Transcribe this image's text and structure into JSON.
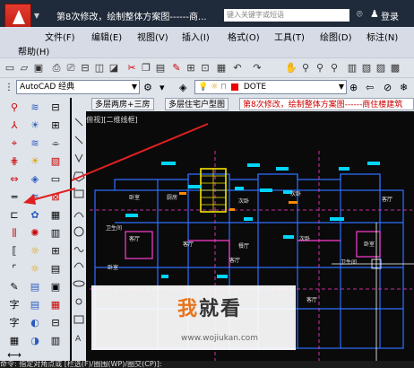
{
  "title_bar": {
    "doc_title": "第8次修改，绘制整体方案图------商...",
    "search_placeholder": "键入关键字或短语",
    "login": "登录"
  },
  "menu": {
    "row1": [
      "文件(F)",
      "编辑(E)",
      "视图(V)",
      "插入(I)",
      "格式(O)",
      "工具(T)",
      "绘图(D)",
      "标注(N)"
    ],
    "row2": [
      "帮助(H)"
    ]
  },
  "toolbar2": {
    "workspace": "AutoCAD 经典",
    "layer": "DOTE"
  },
  "drawing": {
    "tabs": [
      "多层两房+三房",
      "多层住宅户型图",
      "第8次修改，绘制整体方案图------商住楼建筑"
    ],
    "view_label": "[-][俯视][二维线框]",
    "room_labels": [
      "卧室",
      "厨房",
      "次卧",
      "次卧",
      "客厅",
      "卫生间",
      "客厅",
      "客厅",
      "餐厅",
      "次卧",
      "卧室",
      "客厅",
      "卧室",
      "卫生间",
      "客厅",
      "客厅"
    ]
  },
  "command_line": "命令: 指定对角点或 [栏选(F)/圈围(WP)/圈交(CP)]:",
  "watermark": {
    "logo_a": "我",
    "logo_b": "就看",
    "url": "www.wojiukan.com"
  },
  "colors": {
    "accent_red": "#e02020",
    "titlebar": "#1f2a3a",
    "toolbar_bg": "#dfe3ea",
    "plan_wall": "#2e6fff",
    "plan_cyan": "#00d5ff",
    "plan_magenta": "#ff3cd0",
    "plan_yellow": "#f2e400"
  }
}
